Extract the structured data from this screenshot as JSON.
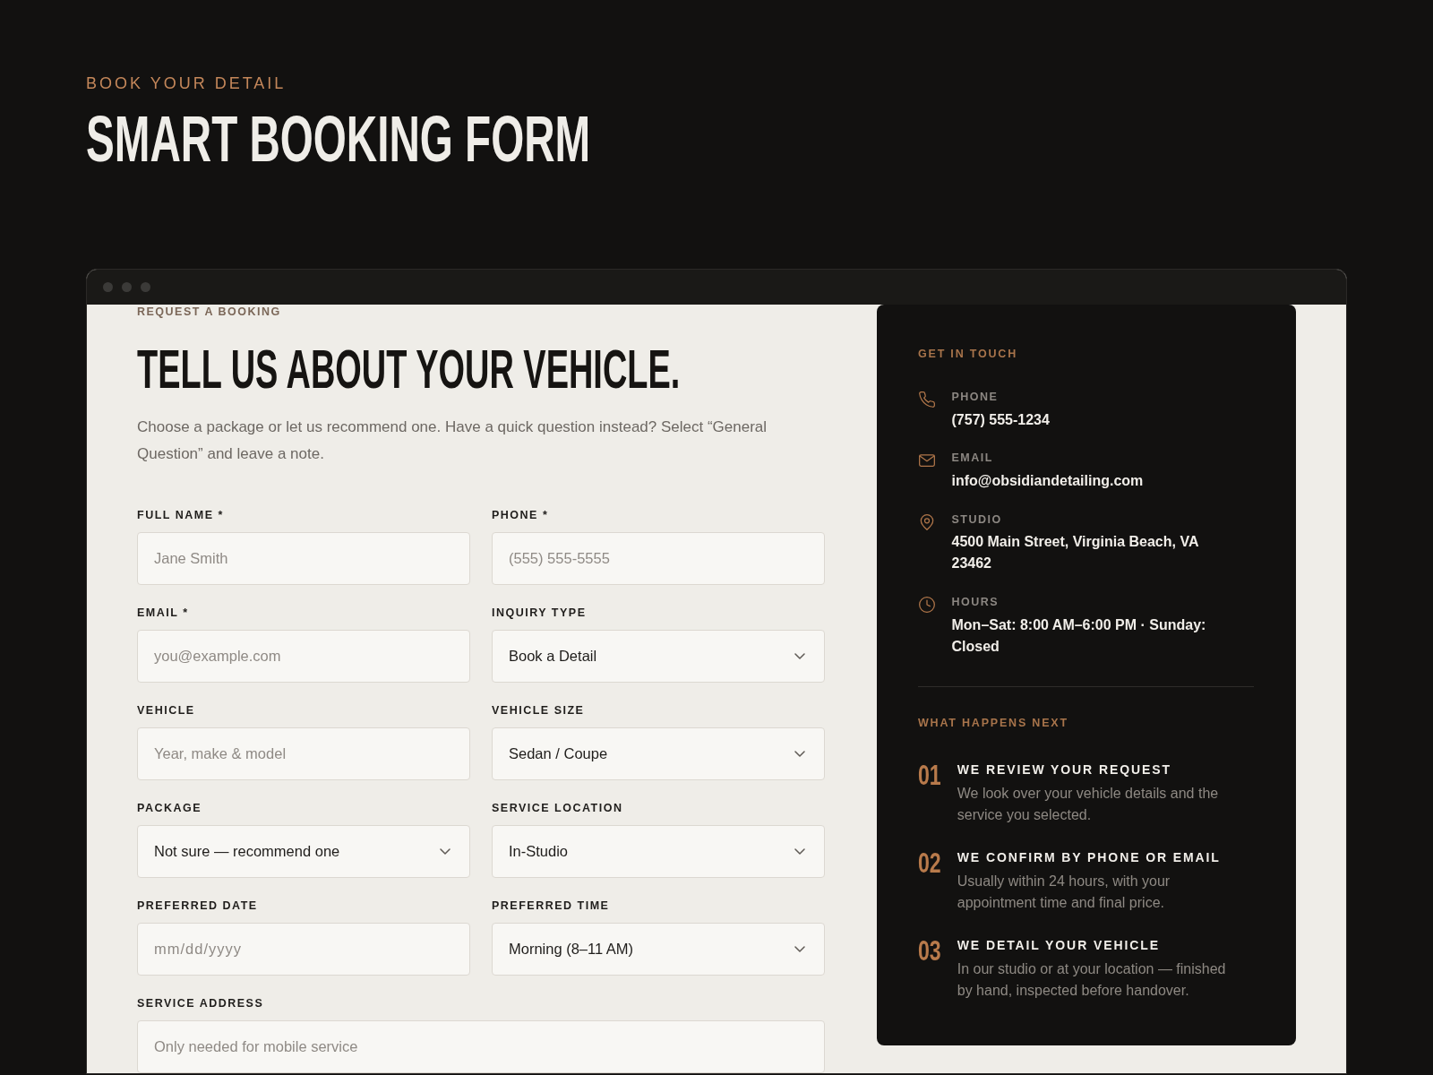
{
  "header": {
    "eyebrow": "BOOK YOUR DETAIL",
    "title": "SMART BOOKING FORM"
  },
  "browser_window": {
    "form": {
      "eyebrow": "REQUEST A BOOKING",
      "title": "TELL US ABOUT YOUR VEHICLE.",
      "intro": "Choose a package or let us recommend one. Have a quick question instead? Select “General Question” and leave a note.",
      "fields": [
        {
          "label": "FULL NAME *",
          "kind": "text",
          "full_width": false,
          "placeholder": "Jane Smith"
        },
        {
          "label": "PHONE *",
          "kind": "text",
          "full_width": false,
          "placeholder": "(555) 555-5555"
        },
        {
          "label": "EMAIL *",
          "kind": "text",
          "full_width": false,
          "placeholder": "you@example.com"
        },
        {
          "label": "INQUIRY TYPE",
          "kind": "select",
          "full_width": false,
          "value": "Book a Detail"
        },
        {
          "label": "VEHICLE",
          "kind": "text",
          "full_width": false,
          "placeholder": "Year, make & model"
        },
        {
          "label": "VEHICLE SIZE",
          "kind": "select",
          "full_width": false,
          "value": "Sedan / Coupe"
        },
        {
          "label": "PACKAGE",
          "kind": "select",
          "full_width": false,
          "value": "Not sure — recommend one"
        },
        {
          "label": "SERVICE LOCATION",
          "kind": "select",
          "full_width": false,
          "value": "In-Studio"
        },
        {
          "label": "PREFERRED DATE",
          "kind": "date",
          "full_width": false,
          "placeholder": "mm/dd/yyyy"
        },
        {
          "label": "PREFERRED TIME",
          "kind": "select",
          "full_width": false,
          "value": "Morning (8–11 AM)"
        },
        {
          "label": "SERVICE ADDRESS",
          "kind": "text",
          "full_width": true,
          "placeholder": "Only needed for mobile service"
        }
      ]
    },
    "contact_panel": {
      "heading": "GET IN TOUCH",
      "contacts": [
        {
          "kind": "phone",
          "label": "PHONE",
          "value": "(757) 555-1234"
        },
        {
          "kind": "email",
          "label": "EMAIL",
          "value": "info@obsidiandetailing.com"
        },
        {
          "kind": "address",
          "label": "STUDIO",
          "value": "4500 Main Street, Virginia Beach, VA 23462"
        },
        {
          "kind": "hours",
          "label": "HOURS",
          "value": "Mon–Sat: 8:00 AM–6:00 PM · Sunday: Closed"
        }
      ],
      "next_heading": "WHAT HAPPENS NEXT",
      "steps": [
        {
          "number": "01",
          "title": "WE REVIEW YOUR REQUEST",
          "text": "We look over your vehicle details and the service you selected."
        },
        {
          "number": "02",
          "title": "WE CONFIRM BY PHONE OR EMAIL",
          "text": "Usually within 24 hours, with your appointment time and final price."
        },
        {
          "number": "03",
          "title": "WE DETAIL YOUR VEHICLE",
          "text": "In our studio or at your location — finished by hand, inspected before handover."
        }
      ]
    }
  }
}
